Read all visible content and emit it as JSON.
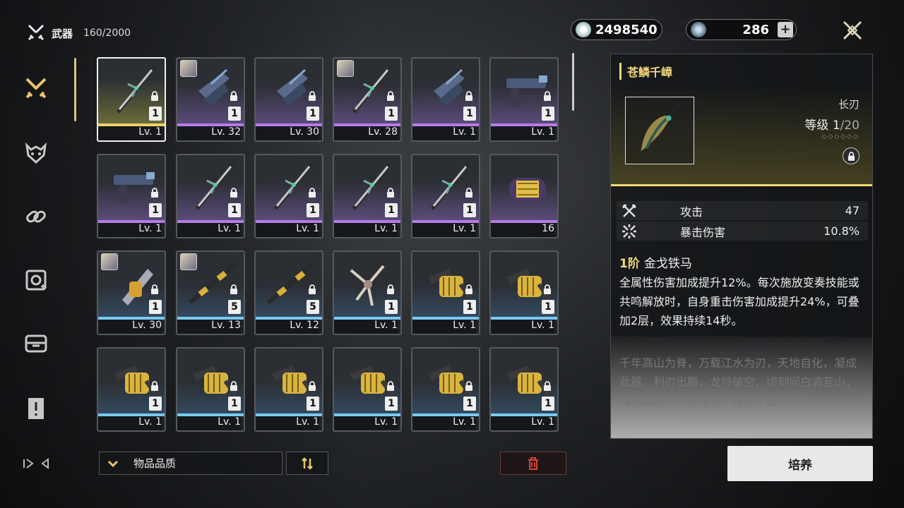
{
  "header": {
    "title": "武器",
    "count": "160/2000"
  },
  "currency": {
    "shells": "2498540",
    "stars": "286",
    "plus": "+"
  },
  "colors": {
    "gold": "#e9d26a",
    "purple": "#b57be8",
    "blue": "#79c9ef",
    "accent": "#f2d870"
  },
  "sidebar": {
    "items": [
      {
        "icon": "crossed-swords-icon",
        "active": true
      },
      {
        "icon": "beast-mask-icon",
        "active": false
      },
      {
        "icon": "chain-link-icon",
        "active": false
      },
      {
        "icon": "gear-module-icon",
        "active": false
      },
      {
        "icon": "box-device-icon",
        "active": false
      },
      {
        "icon": "alert-card-icon",
        "active": false
      }
    ]
  },
  "grid": [
    {
      "rarity": "gold",
      "level": "Lv. 1",
      "qty": "1",
      "selected": true,
      "avatar": false,
      "art": "sword"
    },
    {
      "rarity": "purple",
      "level": "Lv. 32",
      "qty": "1",
      "selected": false,
      "avatar": true,
      "art": "gauntlet"
    },
    {
      "rarity": "purple",
      "level": "Lv. 30",
      "qty": "1",
      "selected": false,
      "avatar": false,
      "art": "gauntlet"
    },
    {
      "rarity": "purple",
      "level": "Lv. 28",
      "qty": "1",
      "selected": false,
      "avatar": true,
      "art": "sword"
    },
    {
      "rarity": "purple",
      "level": "Lv. 1",
      "qty": "1",
      "selected": false,
      "avatar": false,
      "art": "gauntlet"
    },
    {
      "rarity": "purple",
      "level": "Lv. 1",
      "qty": "1",
      "selected": false,
      "avatar": false,
      "art": "pistol"
    },
    {
      "rarity": "purple",
      "level": "Lv. 1",
      "qty": "1",
      "selected": false,
      "avatar": false,
      "art": "pistol"
    },
    {
      "rarity": "purple",
      "level": "Lv. 1",
      "qty": "1",
      "selected": false,
      "avatar": false,
      "art": "sword"
    },
    {
      "rarity": "purple",
      "level": "Lv. 1",
      "qty": "1",
      "selected": false,
      "avatar": false,
      "art": "sword"
    },
    {
      "rarity": "purple",
      "level": "Lv. 1",
      "qty": "1",
      "selected": false,
      "avatar": false,
      "art": "sword"
    },
    {
      "rarity": "purple",
      "level": "Lv. 1",
      "qty": "1",
      "selected": false,
      "avatar": false,
      "art": "sword"
    },
    {
      "rarity": "purple",
      "level": "16",
      "qty": "",
      "selected": false,
      "avatar": false,
      "art": "capsule"
    },
    {
      "rarity": "blue",
      "level": "Lv. 30",
      "qty": "1",
      "selected": false,
      "avatar": true,
      "art": "gauntlet"
    },
    {
      "rarity": "blue",
      "level": "Lv. 13",
      "qty": "5",
      "selected": false,
      "avatar": true,
      "art": "staff"
    },
    {
      "rarity": "blue",
      "level": "Lv. 12",
      "qty": "5",
      "selected": false,
      "avatar": false,
      "art": "staff"
    },
    {
      "rarity": "blue",
      "level": "Lv. 1",
      "qty": "1",
      "selected": false,
      "avatar": false,
      "art": "claw"
    },
    {
      "rarity": "blue",
      "level": "Lv. 1",
      "qty": "1",
      "selected": false,
      "avatar": false,
      "art": "gauntlet"
    },
    {
      "rarity": "blue",
      "level": "Lv. 1",
      "qty": "1",
      "selected": false,
      "avatar": false,
      "art": "gauntlet"
    },
    {
      "rarity": "blue",
      "level": "Lv. 1",
      "qty": "1",
      "selected": false,
      "avatar": false,
      "art": "gauntlet"
    },
    {
      "rarity": "blue",
      "level": "Lv. 1",
      "qty": "1",
      "selected": false,
      "avatar": false,
      "art": "gauntlet"
    },
    {
      "rarity": "blue",
      "level": "Lv. 1",
      "qty": "1",
      "selected": false,
      "avatar": false,
      "art": "gauntlet"
    },
    {
      "rarity": "blue",
      "level": "Lv. 1",
      "qty": "1",
      "selected": false,
      "avatar": false,
      "art": "gauntlet"
    },
    {
      "rarity": "blue",
      "level": "Lv. 1",
      "qty": "1",
      "selected": false,
      "avatar": false,
      "art": "gauntlet"
    },
    {
      "rarity": "blue",
      "level": "Lv. 1",
      "qty": "1",
      "selected": false,
      "avatar": false,
      "art": "gauntlet"
    }
  ],
  "filter": {
    "sort_label": "物品品质"
  },
  "detail": {
    "name": "苍鳞千嶂",
    "type": "长刃",
    "level_label": "等级",
    "level_value": "1",
    "level_max": "/20",
    "diamonds": "◇◇◇◇◇◇",
    "stats": [
      {
        "icon": "attack-icon",
        "label": "攻击",
        "value": "47"
      },
      {
        "icon": "crit-damage-icon",
        "label": "暴击伤害",
        "value": "10.8%"
      }
    ],
    "skill_tier": "1阶",
    "skill_name": "金戈铁马",
    "skill_desc": "全属性伤害加成提升12%。每次施放变奏技能或共鸣解放时，自身重击伤害加成提升24%，可叠加2层，效果持续14秒。",
    "lore": "千年高山为脊，万载江水为刃，天地自化，凝成此器。利刃出鞘，龙吟破空，顷刻间白波若山，海水震荡，声佯鬼神，惮赫千里。",
    "train_label": "培养"
  }
}
